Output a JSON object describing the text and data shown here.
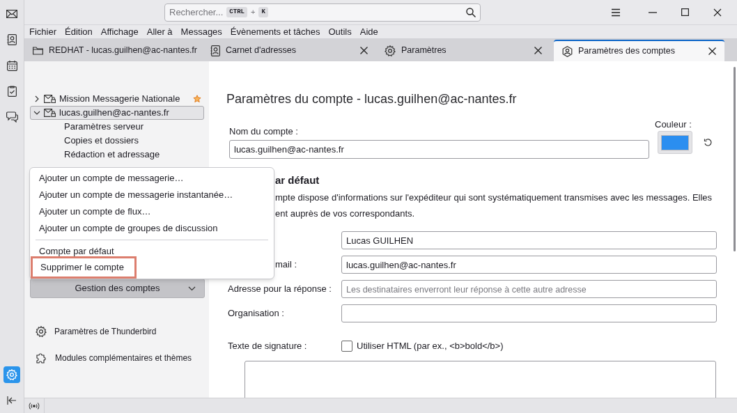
{
  "search": {
    "placeholder": "Rechercher...",
    "keys": [
      "CTRL",
      "K"
    ],
    "joiner": "+"
  },
  "menu_bar": [
    "Fichier",
    "Édition",
    "Affichage",
    "Aller à",
    "Messages",
    "Évènements et tâches",
    "Outils",
    "Aide"
  ],
  "spaces": [
    {
      "kind": "mail",
      "selected": false
    },
    {
      "kind": "contacts",
      "selected": false
    },
    {
      "kind": "calendar",
      "selected": false
    },
    {
      "kind": "tasks",
      "selected": false
    },
    {
      "kind": "chat",
      "selected": false
    },
    {
      "kind": "settings",
      "selected": true
    }
  ],
  "tabs": [
    {
      "kind": "folder",
      "label": "REDHAT - lucas.guilhen@ac-nantes.fr",
      "closable": false,
      "selected": false
    },
    {
      "kind": "contacts",
      "label": "Carnet d'adresses",
      "closable": true,
      "selected": false
    },
    {
      "kind": "gear",
      "label": "Paramètres",
      "closable": true,
      "selected": false
    },
    {
      "kind": "account",
      "label": "Paramètres des comptes",
      "closable": true,
      "selected": true
    }
  ],
  "accounts": [
    {
      "label": "Mission Messagerie Nationale",
      "expanded": false,
      "selected": false,
      "default": true
    },
    {
      "label": "lucas.guilhen@ac-nantes.fr",
      "expanded": true,
      "selected": true,
      "default": false,
      "children": [
        {
          "label": "Paramètres serveur"
        },
        {
          "label": "Copies et dossiers"
        },
        {
          "label": "Rédaction et adressage"
        }
      ]
    }
  ],
  "account_actions": {
    "label": "Gestion des comptes"
  },
  "footer_links": [
    {
      "kind": "gear",
      "label": "Paramètres de Thunderbird"
    },
    {
      "kind": "puzzle",
      "label": "Modules complémentaires et thèmes"
    }
  ],
  "popup_menu": [
    {
      "kind": "item",
      "label": "Ajouter un compte de messagerie…",
      "highlighted": false
    },
    {
      "kind": "item",
      "label": "Ajouter un compte de messagerie instantanée…",
      "highlighted": false
    },
    {
      "kind": "item",
      "label": "Ajouter un compte de flux…",
      "highlighted": false
    },
    {
      "kind": "item",
      "label": "Ajouter un compte de groupes de discussion",
      "highlighted": false
    },
    {
      "kind": "separator"
    },
    {
      "kind": "item",
      "label": "Compte par défaut",
      "highlighted": false
    },
    {
      "kind": "item",
      "label": "Supprimer le compte",
      "highlighted": true
    }
  ],
  "main": {
    "title": "Paramètres du compte - lucas.guilhen@ac-nantes.fr",
    "account_name": {
      "label": "Nom du compte :",
      "value": "lucas.guilhen@ac-nantes.fr"
    },
    "color": {
      "label": "Couleur :",
      "color": "#2b8ef0"
    },
    "identity": {
      "heading": "ar défaut",
      "description": [
        "mpte dispose d'informations sur l'expéditeur qui sont systématiquement transmises avec les messages. Elles",
        "ent auprès de vos correspondants."
      ]
    },
    "fields": [
      {
        "value": "Lucas GUILHEN"
      },
      {
        "label": "mail :",
        "value": "lucas.guilhen@ac-nantes.fr"
      },
      {
        "label": "Adresse pour la réponse :",
        "placeholder": "Les destinataires enverront leur réponse à cette autre adresse"
      },
      {
        "label": "Organisation :"
      }
    ],
    "signature": {
      "label": "Texte de signature :",
      "checkbox_label": "Utiliser HTML (par ex., <b>bold</b>)",
      "checked": false
    }
  }
}
